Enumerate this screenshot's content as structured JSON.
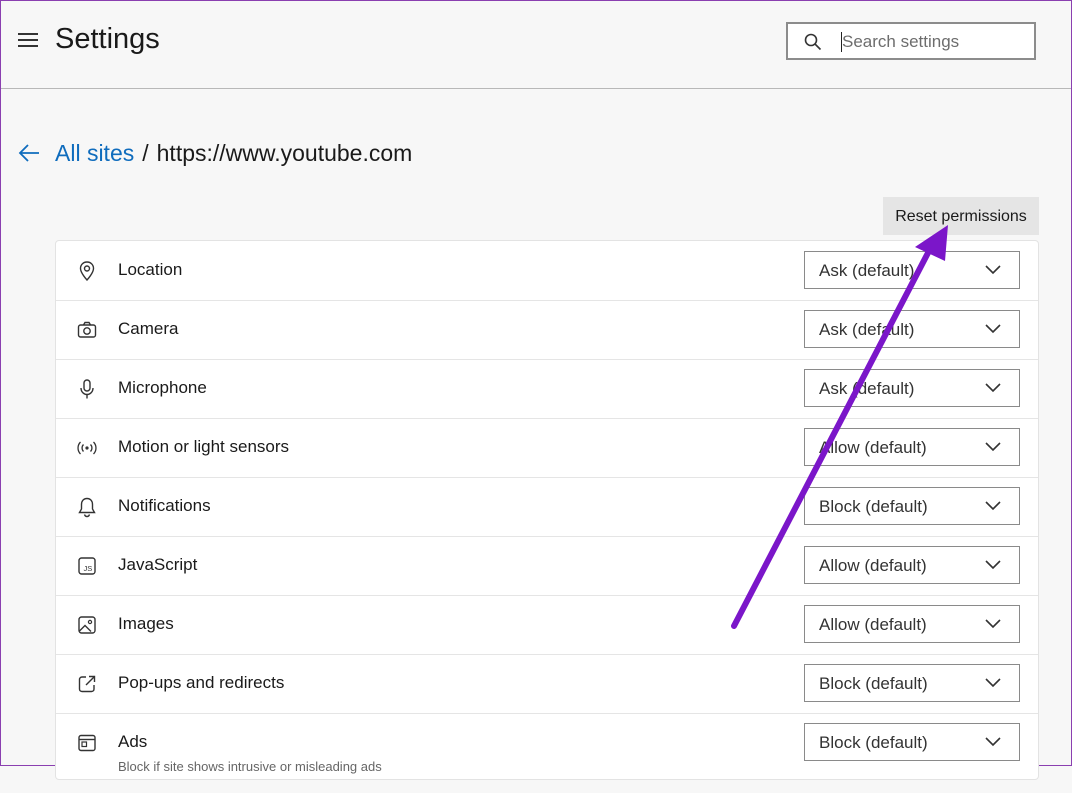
{
  "header": {
    "title": "Settings",
    "search_placeholder": "Search settings"
  },
  "breadcrumb": {
    "parent": "All sites",
    "separator": "/",
    "current": "https://www.youtube.com"
  },
  "reset_label": "Reset permissions",
  "permissions": [
    {
      "label": "Location",
      "value": "Ask (default)",
      "icon": "location-icon"
    },
    {
      "label": "Camera",
      "value": "Ask (default)",
      "icon": "camera-icon"
    },
    {
      "label": "Microphone",
      "value": "Ask (default)",
      "icon": "microphone-icon"
    },
    {
      "label": "Motion or light sensors",
      "value": "Allow (default)",
      "icon": "sensors-icon"
    },
    {
      "label": "Notifications",
      "value": "Block (default)",
      "icon": "bell-icon"
    },
    {
      "label": "JavaScript",
      "value": "Allow (default)",
      "icon": "javascript-icon"
    },
    {
      "label": "Images",
      "value": "Allow (default)",
      "icon": "image-icon"
    },
    {
      "label": "Pop-ups and redirects",
      "value": "Block (default)",
      "icon": "popup-icon"
    },
    {
      "label": "Ads",
      "value": "Block (default)",
      "icon": "ads-icon",
      "description": "Block if site shows intrusive or misleading ads"
    }
  ],
  "colors": {
    "link": "#0f6cbd",
    "annotation_arrow": "#7b16c9"
  }
}
